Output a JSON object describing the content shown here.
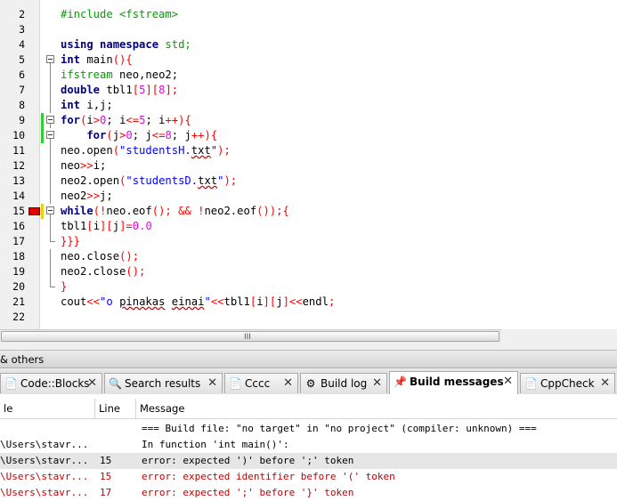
{
  "editor": {
    "lines": [
      {
        "n": "2",
        "tokens": [
          {
            "t": "#include <fstream>",
            "c": "pp"
          }
        ]
      },
      {
        "n": "3",
        "tokens": []
      },
      {
        "n": "4",
        "tokens": [
          {
            "t": "using namespace",
            "c": "kw"
          },
          {
            "t": " std;",
            "c": "pp"
          }
        ]
      },
      {
        "n": "5",
        "fold": "box",
        "tokens": [
          {
            "t": "int",
            "c": "kw"
          },
          {
            "t": " main",
            "c": "tx"
          },
          {
            "t": "(){",
            "c": "op"
          }
        ]
      },
      {
        "n": "6",
        "fold": "line",
        "tokens": [
          {
            "t": "ifstream",
            "c": "pp"
          },
          {
            "t": " neo,neo2;",
            "c": "tx"
          }
        ]
      },
      {
        "n": "7",
        "fold": "line",
        "tokens": [
          {
            "t": "double",
            "c": "kw"
          },
          {
            "t": " tbl1",
            "c": "tx"
          },
          {
            "t": "[",
            "c": "op"
          },
          {
            "t": "5",
            "c": "num"
          },
          {
            "t": "][",
            "c": "op"
          },
          {
            "t": "8",
            "c": "num"
          },
          {
            "t": "];",
            "c": "op"
          }
        ]
      },
      {
        "n": "8",
        "fold": "line",
        "tokens": [
          {
            "t": "int",
            "c": "kw"
          },
          {
            "t": " i,j;",
            "c": "tx"
          }
        ]
      },
      {
        "n": "9",
        "fold": "box",
        "changed": true,
        "tokens": [
          {
            "t": "for",
            "c": "kw"
          },
          {
            "t": "(",
            "c": "op"
          },
          {
            "t": "i",
            "c": "tx"
          },
          {
            "t": ">",
            "c": "op"
          },
          {
            "t": "0",
            "c": "num"
          },
          {
            "t": "; i",
            "c": "tx"
          },
          {
            "t": "<=",
            "c": "op"
          },
          {
            "t": "5",
            "c": "num"
          },
          {
            "t": "; i",
            "c": "tx"
          },
          {
            "t": "++){",
            "c": "op"
          }
        ]
      },
      {
        "n": "10",
        "fold": "box",
        "changed": true,
        "tokens": [
          {
            "t": "    for",
            "c": "kw"
          },
          {
            "t": "(",
            "c": "op"
          },
          {
            "t": "j",
            "c": "tx"
          },
          {
            "t": ">",
            "c": "op"
          },
          {
            "t": "0",
            "c": "num"
          },
          {
            "t": "; j",
            "c": "tx"
          },
          {
            "t": "<=",
            "c": "op"
          },
          {
            "t": "8",
            "c": "num"
          },
          {
            "t": "; j",
            "c": "tx"
          },
          {
            "t": "++){",
            "c": "op"
          }
        ]
      },
      {
        "n": "11",
        "fold": "line",
        "tokens": [
          {
            "t": "neo.open",
            "c": "tx"
          },
          {
            "t": "(",
            "c": "op"
          },
          {
            "t": "\"studentsH.",
            "c": "str"
          },
          {
            "t": "txt",
            "c": "sq"
          },
          {
            "t": "\"",
            "c": "str"
          },
          {
            "t": ");",
            "c": "op"
          }
        ]
      },
      {
        "n": "12",
        "fold": "line",
        "tokens": [
          {
            "t": "neo",
            "c": "tx"
          },
          {
            "t": ">>",
            "c": "op"
          },
          {
            "t": "i;",
            "c": "tx"
          }
        ]
      },
      {
        "n": "13",
        "fold": "line",
        "tokens": [
          {
            "t": "neo2.open",
            "c": "tx"
          },
          {
            "t": "(",
            "c": "op"
          },
          {
            "t": "\"studentsD.",
            "c": "str"
          },
          {
            "t": "txt",
            "c": "sq"
          },
          {
            "t": "\"",
            "c": "str"
          },
          {
            "t": ");",
            "c": "op"
          }
        ]
      },
      {
        "n": "14",
        "fold": "line",
        "tokens": [
          {
            "t": "neo2",
            "c": "tx"
          },
          {
            "t": ">>",
            "c": "op"
          },
          {
            "t": "j;",
            "c": "tx"
          }
        ]
      },
      {
        "n": "15",
        "fold": "box",
        "error": true,
        "changed": true,
        "tokens": [
          {
            "t": "while",
            "c": "kw"
          },
          {
            "t": "(!",
            "c": "op"
          },
          {
            "t": "neo.eof",
            "c": "tx"
          },
          {
            "t": "();",
            "c": "op"
          },
          {
            "t": " && !",
            "c": "op"
          },
          {
            "t": "neo2.eof",
            "c": "tx"
          },
          {
            "t": "());{",
            "c": "op"
          }
        ]
      },
      {
        "n": "16",
        "fold": "line",
        "tokens": [
          {
            "t": "tbl1",
            "c": "tx"
          },
          {
            "t": "[",
            "c": "op"
          },
          {
            "t": "i",
            "c": "tx"
          },
          {
            "t": "][",
            "c": "op"
          },
          {
            "t": "j",
            "c": "tx"
          },
          {
            "t": "]=",
            "c": "op"
          },
          {
            "t": "0.0",
            "c": "num"
          }
        ]
      },
      {
        "n": "17",
        "fold": "end",
        "tokens": [
          {
            "t": "}}}",
            "c": "op"
          }
        ]
      },
      {
        "n": "18",
        "fold": "line",
        "tokens": [
          {
            "t": "neo.close",
            "c": "tx"
          },
          {
            "t": "();",
            "c": "op"
          }
        ]
      },
      {
        "n": "19",
        "fold": "line",
        "tokens": [
          {
            "t": "neo2.close",
            "c": "tx"
          },
          {
            "t": "();",
            "c": "op"
          }
        ]
      },
      {
        "n": "20",
        "fold": "end",
        "tokens": [
          {
            "t": "}",
            "c": "op"
          }
        ]
      },
      {
        "n": "21",
        "tokens": [
          {
            "t": "cout",
            "c": "tx"
          },
          {
            "t": "<<",
            "c": "op"
          },
          {
            "t": "\"o ",
            "c": "str"
          },
          {
            "t": "pinakas",
            "c": "sq"
          },
          {
            "t": " ",
            "c": "str"
          },
          {
            "t": "einai",
            "c": "sq"
          },
          {
            "t": "\"",
            "c": "str"
          },
          {
            "t": "<<",
            "c": "op"
          },
          {
            "t": "tbl1",
            "c": "tx"
          },
          {
            "t": "[",
            "c": "op"
          },
          {
            "t": "i",
            "c": "tx"
          },
          {
            "t": "][",
            "c": "op"
          },
          {
            "t": "j",
            "c": "tx"
          },
          {
            "t": "]<<",
            "c": "op"
          },
          {
            "t": "endl",
            "c": "tx"
          },
          {
            "t": ";",
            "c": "op"
          }
        ]
      },
      {
        "n": "22",
        "tokens": []
      }
    ]
  },
  "scrollbar": {
    "grip": "III"
  },
  "logs": {
    "title": "& others",
    "tabs": [
      {
        "label": "Code::Blocks",
        "icon": "document-icon",
        "glyph": "📄"
      },
      {
        "label": "Search results",
        "icon": "search-icon",
        "glyph": "🔍"
      },
      {
        "label": "Cccc",
        "icon": "document-icon",
        "glyph": "📄"
      },
      {
        "label": "Build log",
        "icon": "gear-icon",
        "glyph": "⚙"
      },
      {
        "label": "Build messages",
        "icon": "pushpin-icon",
        "glyph": "📌",
        "active": true
      },
      {
        "label": "CppCheck",
        "icon": "document-icon",
        "glyph": "📄"
      }
    ],
    "close_glyph": "✕",
    "columns": [
      "le",
      "Line",
      "Message"
    ],
    "rows": [
      {
        "file": "",
        "line": "",
        "message": "=== Build file: \"no target\" in \"no project\" (compiler: unknown) ===",
        "style": "normal"
      },
      {
        "file": "\\Users\\stavr...",
        "line": "",
        "message": "In function 'int main()':",
        "style": "normal"
      },
      {
        "file": "\\Users\\stavr...",
        "line": "15",
        "message": "error: expected ')' before ';' token",
        "style": "selected"
      },
      {
        "file": "\\Users\\stavr...",
        "line": "15",
        "message": "error: expected identifier before '(' token",
        "style": "red"
      },
      {
        "file": "\\Users\\stavr...",
        "line": "17",
        "message": "error: expected ';' before '}' token",
        "style": "red"
      }
    ]
  }
}
